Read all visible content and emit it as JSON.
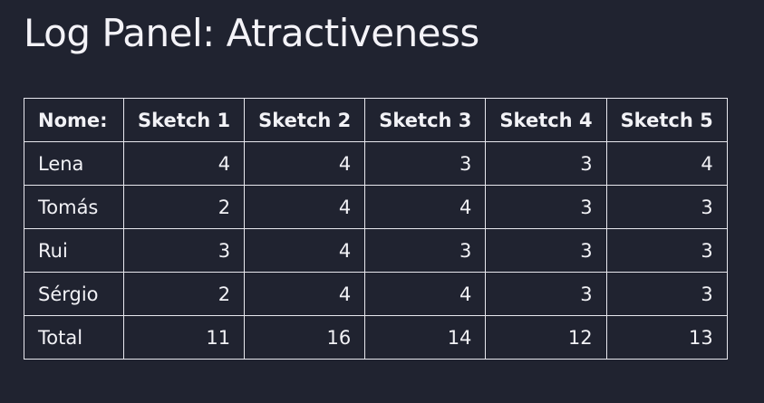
{
  "title": "Log Panel: Atractiveness",
  "table": {
    "headers": [
      "Nome:",
      "Sketch 1",
      "Sketch 2",
      "Sketch 3",
      "Sketch 4",
      "Sketch 5"
    ],
    "rows": [
      [
        "Lena",
        "4",
        "4",
        "3",
        "3",
        "4"
      ],
      [
        "Tomás",
        "2",
        "4",
        "4",
        "3",
        "3"
      ],
      [
        "Rui",
        "3",
        "4",
        "3",
        "3",
        "3"
      ],
      [
        "Sérgio",
        "2",
        "4",
        "4",
        "3",
        "3"
      ],
      [
        "Total",
        "11",
        "16",
        "14",
        "12",
        "13"
      ]
    ]
  }
}
